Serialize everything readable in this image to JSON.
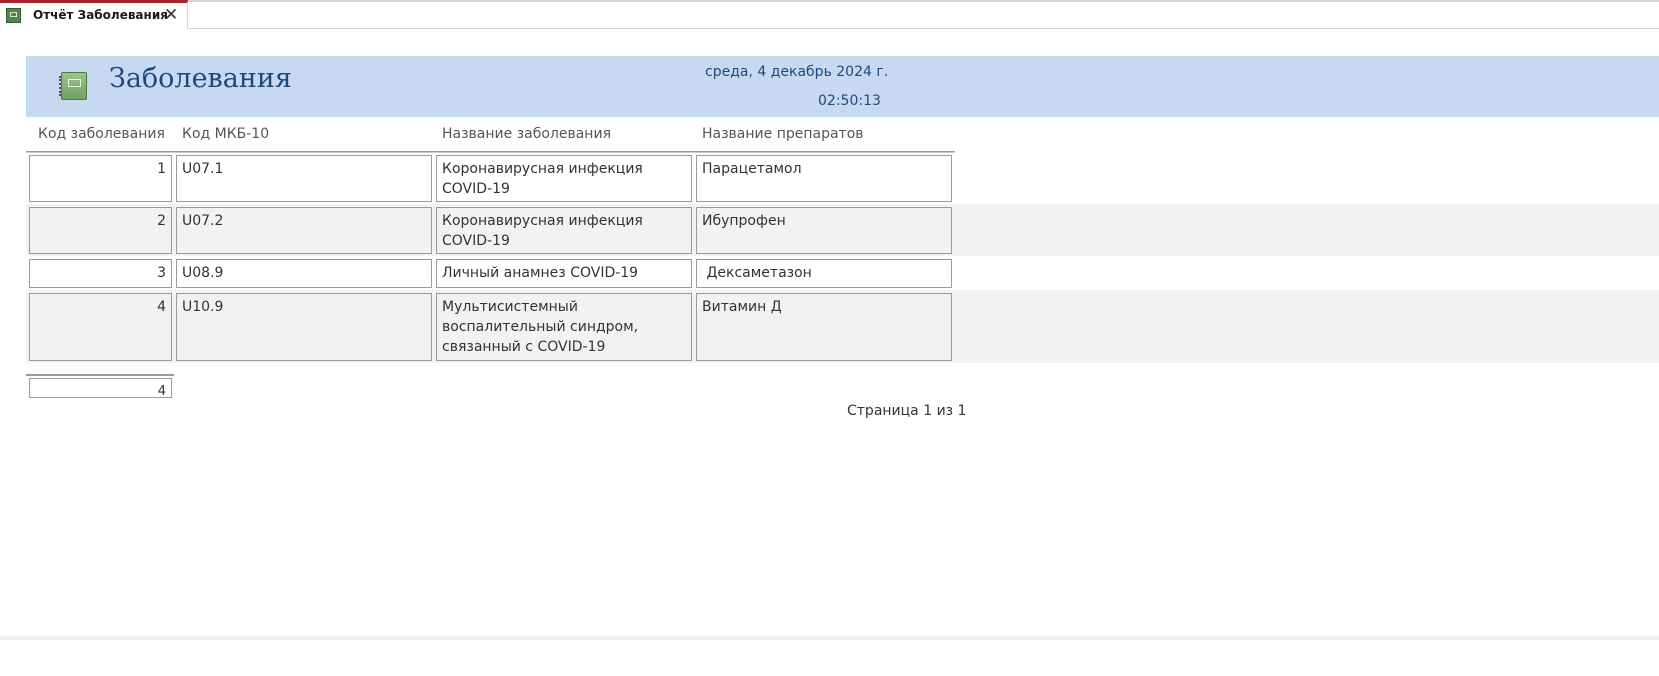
{
  "tab": {
    "title": "Отчёт Заболевания",
    "close_glyph": "✕"
  },
  "report": {
    "title": "Заболевания",
    "date": "среда, 4 декабрь 2024 г.",
    "time": "02:50:13",
    "columns": [
      "Код заболевания",
      "Код МКБ-10",
      "Название заболевания",
      "Название препаратов"
    ],
    "rows": [
      {
        "id": "1",
        "icd": "U07.1",
        "name_l1": "Коронавирусная инфекция",
        "name_l2": "COVID-19",
        "name_l3": "",
        "drug": "Парацетамол"
      },
      {
        "id": "2",
        "icd": "U07.2",
        "name_l1": "Коронавирусная инфекция",
        "name_l2": "COVID-19",
        "name_l3": "",
        "drug": "Ибупрофен"
      },
      {
        "id": "3",
        "icd": "U08.9",
        "name_l1": "Личный анамнез COVID-19",
        "name_l2": "",
        "name_l3": "",
        "drug": " Дексаметазон"
      },
      {
        "id": "4",
        "icd": "U10.9",
        "name_l1": "Мультисистемный",
        "name_l2": "воспалительный синдром,",
        "name_l3": "связанный с COVID-19",
        "drug": "Витамин Д"
      }
    ],
    "total_count": "4",
    "page_number": "Страница 1 из 1"
  },
  "colors": {
    "header_band": "#c6d9f1",
    "title_text": "#1f497d",
    "alt_row": "#f2f2f2",
    "tab_accent": "#a4262c"
  },
  "icons": {
    "tab_icon": "report-icon",
    "header_icon": "report-icon"
  }
}
